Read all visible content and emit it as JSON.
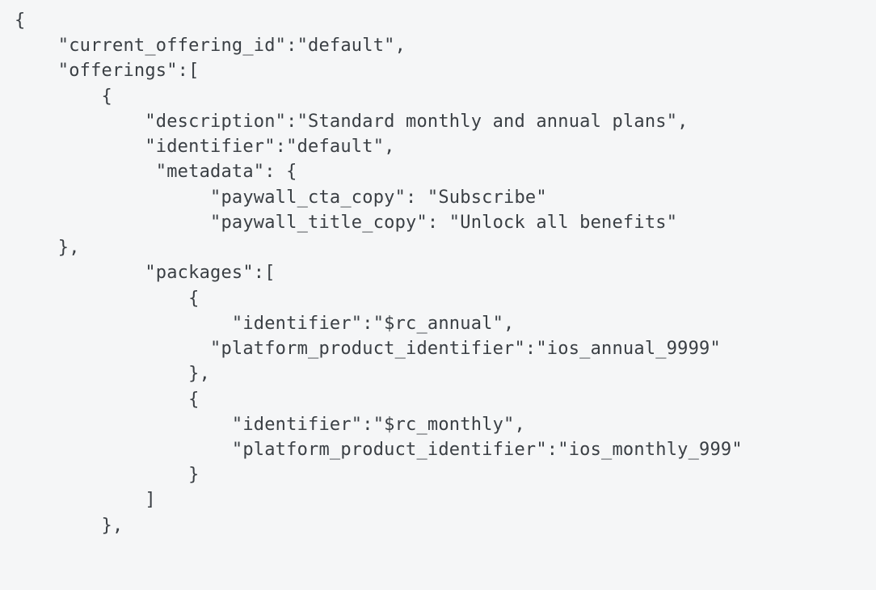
{
  "code": {
    "lines": [
      "{",
      "    \"current_offering_id\":\"default\",",
      "    \"offerings\":[",
      "        {",
      "            \"description\":\"Standard monthly and annual plans\",",
      "            \"identifier\":\"default\",",
      "             \"metadata\": {",
      "                  \"paywall_cta_copy\": \"Subscribe\"",
      "                  \"paywall_title_copy\": \"Unlock all benefits\"",
      "    },",
      "            \"packages\":[",
      "                {",
      "                    \"identifier\":\"$rc_annual\",",
      "                  \"platform_product_identifier\":\"ios_annual_9999\"",
      "                },",
      "                {",
      "                    \"identifier\":\"$rc_monthly\",",
      "                    \"platform_product_identifier\":\"ios_monthly_999\"",
      "                }",
      "            ]",
      "        },"
    ]
  }
}
